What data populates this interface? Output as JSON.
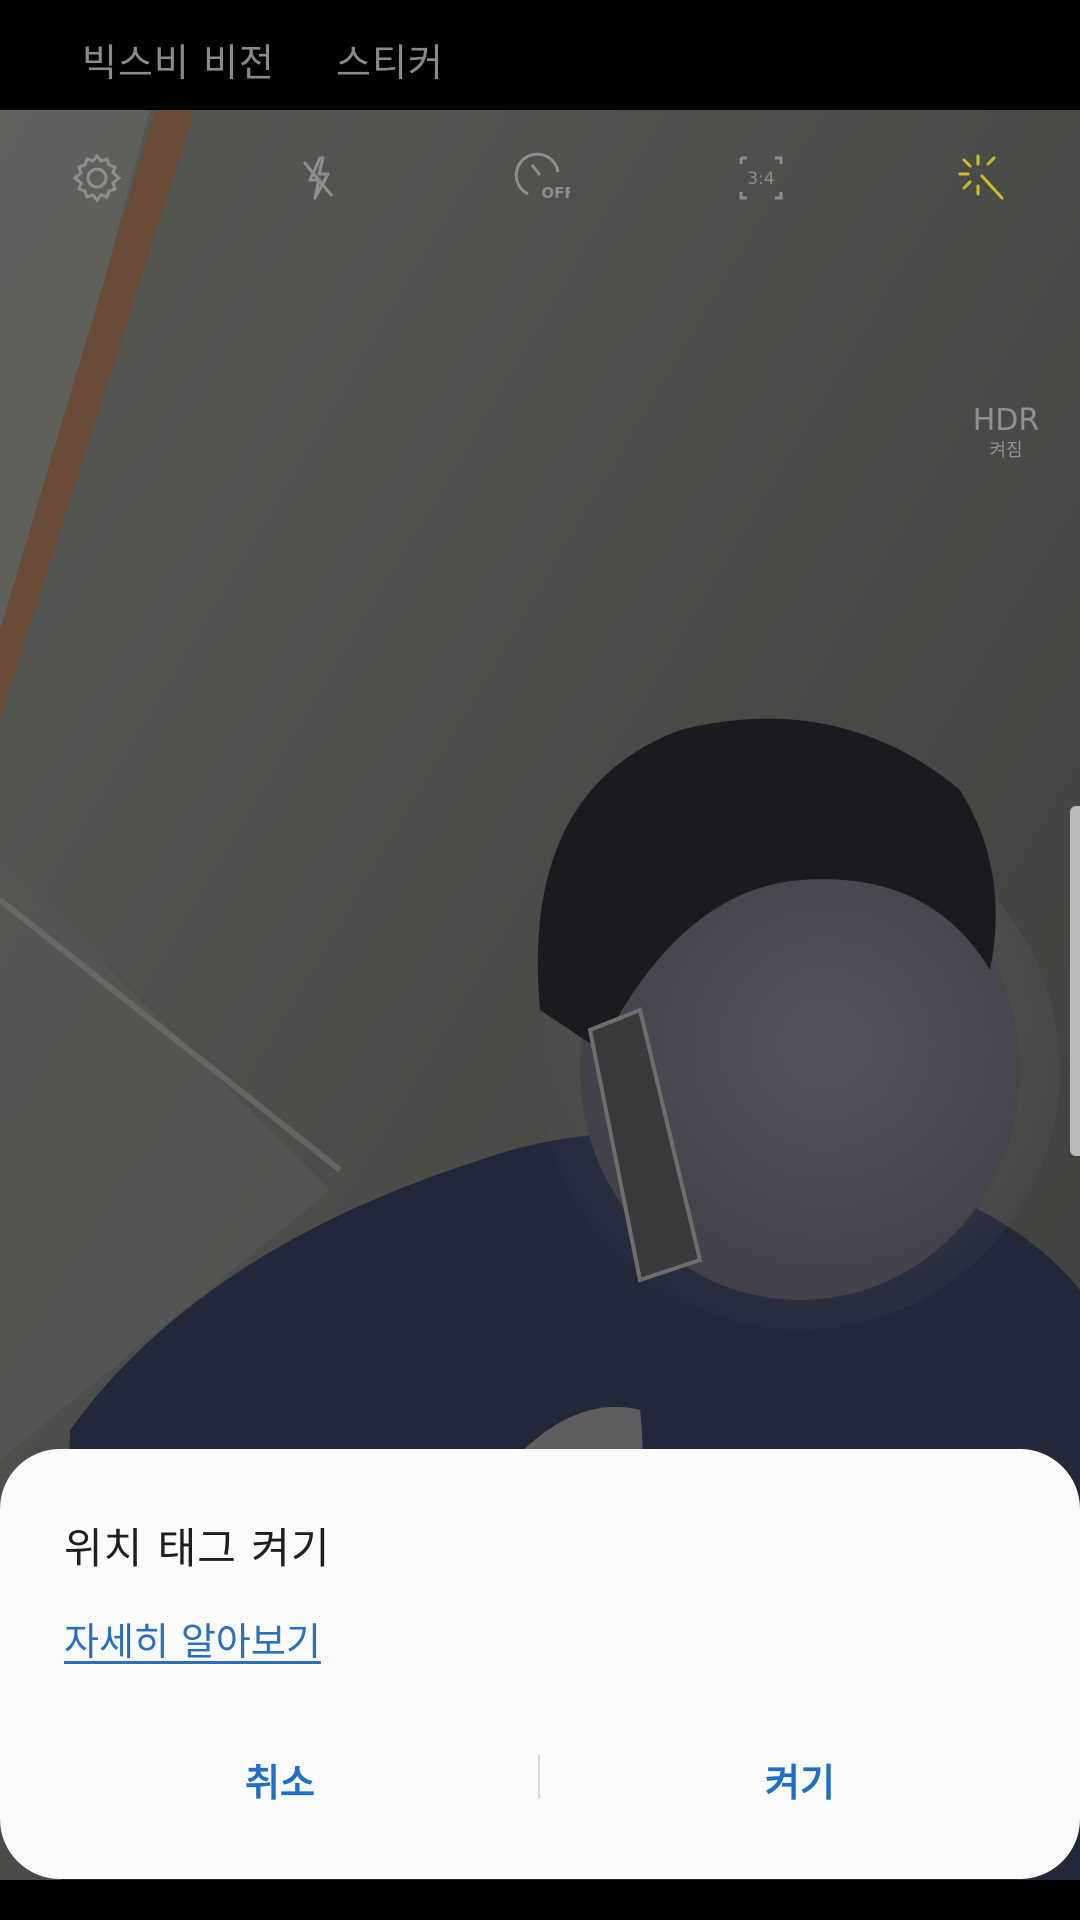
{
  "mode_bar": {
    "tabs": [
      {
        "label": "빅스비 비전"
      },
      {
        "label": "스티커"
      }
    ]
  },
  "quick_settings": {
    "icons": [
      {
        "name": "settings-icon"
      },
      {
        "name": "flash-off-icon"
      },
      {
        "name": "timer-off-icon",
        "text": "OFF"
      },
      {
        "name": "aspect-ratio-icon",
        "text": "3:4"
      },
      {
        "name": "effects-icon",
        "color": "#c8c01e"
      }
    ]
  },
  "hdr": {
    "label": "HDR",
    "status": "켜짐"
  },
  "dialog": {
    "title": "위치 태그 켜기",
    "link": "자세히 알아보기",
    "cancel_label": "취소",
    "ok_label": "켜기"
  },
  "colors": {
    "accent": "#1f6fc8",
    "link": "#2a6fc0",
    "effects_active": "#c8c01e",
    "dialog_bg": "#fbfbfb"
  }
}
